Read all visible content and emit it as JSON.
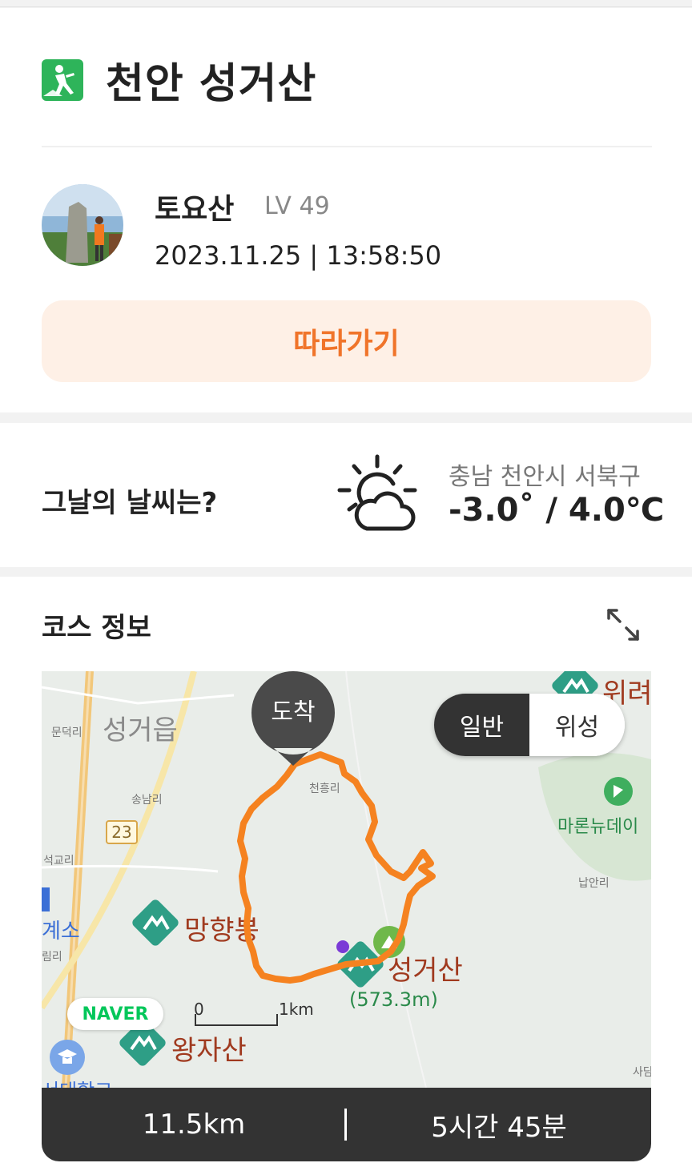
{
  "header": {
    "title": "천안 성거산",
    "icon": "hiking-icon",
    "icon_color": "#2eb45a"
  },
  "user": {
    "name": "토요산",
    "level": "LV 49",
    "datetime": "2023.11.25 | 13:58:50"
  },
  "follow_button": {
    "label": "따라가기",
    "color": "#f0742a",
    "bg": "#fef0e6"
  },
  "weather": {
    "label": "그날의 날씨는?",
    "icon": "partly-cloudy-icon",
    "location": "충남 천안시 서북구",
    "temperature": "-3.0˚ / 4.0℃"
  },
  "course": {
    "label": "코스 정보",
    "expand_icon": "expand-icon",
    "map": {
      "arrival_marker": "도착",
      "view_toggle": {
        "normal": "일반",
        "satellite": "위성",
        "selected": "일반"
      },
      "labels": {
        "town": "성거읍",
        "mundeok": "문덕리",
        "songnam": "송남리",
        "seokgyo": "석교리",
        "cheonheung": "천흥리",
        "naman": "납안리",
        "gyeso": "계소",
        "ri": "림리",
        "sadam": "사담",
        "daehak": "서대학교",
        "route_number": "23",
        "manghyang": "망향봉",
        "seonggeo": "성거산",
        "seonggeo_elev": "(573.3m)",
        "wangja": "왕자산",
        "wiryeo": "위려",
        "maron": "마론뉴데이",
        "scale_0": "0",
        "scale_1": "1km"
      },
      "logo": "NAVER",
      "route_color": "#f58220"
    },
    "stats": {
      "distance": "11.5km",
      "duration": "5시간 45분"
    }
  }
}
